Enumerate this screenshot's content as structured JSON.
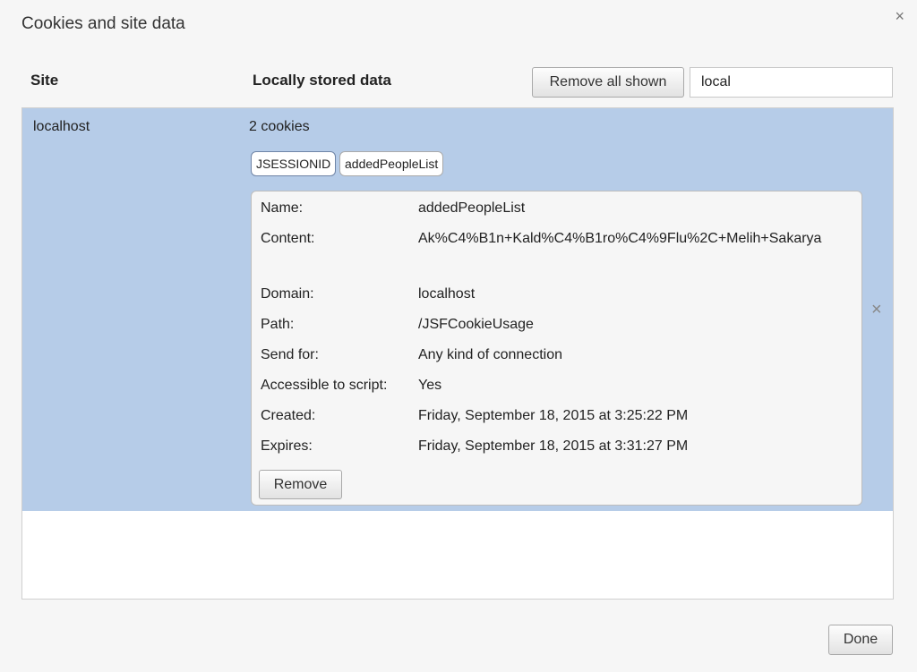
{
  "dialog": {
    "title": "Cookies and site data",
    "close_glyph": "×"
  },
  "header": {
    "site": "Site",
    "locally_stored": "Locally stored data",
    "remove_all_label": "Remove all shown",
    "search_value": "local"
  },
  "site_row": {
    "site": "localhost",
    "count": "2 cookies",
    "cookies": [
      "JSESSIONID",
      "addedPeopleList"
    ],
    "delete_glyph": "×"
  },
  "details": {
    "rows": [
      {
        "label": "Name:",
        "value": "addedPeopleList"
      },
      {
        "label": "Content:",
        "value": "Ak%C4%B1n+Kald%C4%B1ro%C4%9Flu%2C+Melih+Sakarya"
      },
      {
        "label": "Domain:",
        "value": "localhost"
      },
      {
        "label": "Path:",
        "value": "/JSFCookieUsage"
      },
      {
        "label": "Send for:",
        "value": "Any kind of connection"
      },
      {
        "label": "Accessible to script:",
        "value": "Yes"
      },
      {
        "label": "Created:",
        "value": "Friday, September 18, 2015 at 3:25:22 PM"
      },
      {
        "label": "Expires:",
        "value": "Friday, September 18, 2015 at 3:31:27 PM"
      }
    ],
    "remove_label": "Remove"
  },
  "footer": {
    "done_label": "Done"
  }
}
